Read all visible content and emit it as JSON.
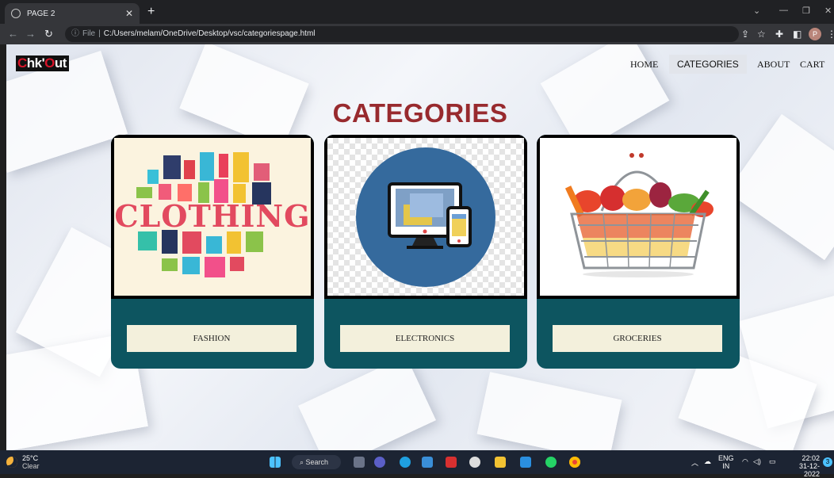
{
  "browser": {
    "tab_title": "PAGE 2",
    "url_prefix": "File",
    "url": "C:/Users/melam/OneDrive/Desktop/vsc/categoriespage.html",
    "profile_initial": "P"
  },
  "site": {
    "logo_part1": "C",
    "logo_part2": "hk'",
    "logo_part3": "O",
    "logo_part4": "ut",
    "nav": [
      "HOME",
      "CATEGORIES",
      "ABOUT",
      "CART"
    ],
    "active_nav": "CATEGORIES",
    "heading": "CATEGORIES",
    "cards": [
      {
        "label": "FASHION",
        "image": "clothing-illustration",
        "image_text": "CLOTHING"
      },
      {
        "label": "ELECTRONICS",
        "image": "devices-icon"
      },
      {
        "label": "GROCERIES",
        "image": "vegetable-basket"
      }
    ]
  },
  "taskbar": {
    "temp": "25°C",
    "condition": "Clear",
    "search": "Search",
    "lang1": "ENG",
    "lang2": "IN",
    "time": "22:02",
    "date": "31-12-2022",
    "notif_count": "3"
  },
  "colors": {
    "heading": "#982a2e",
    "card_bg": "#0d5560",
    "label_bg": "#f3f0dc",
    "logo_red": "#d8152a"
  }
}
